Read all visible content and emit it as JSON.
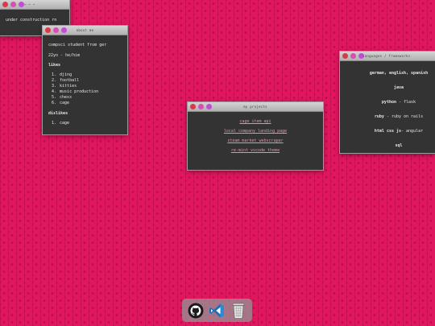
{
  "windows": {
    "construction": {
      "title": "~ ~ ~",
      "text": "under construction rn"
    },
    "about": {
      "title": "about me",
      "line1": "compsci student from ger",
      "line2": "22yo - he/him",
      "likes_heading": "likes",
      "likes": [
        {
          "num": "1.",
          "text": "djing"
        },
        {
          "num": "2.",
          "text": "football"
        },
        {
          "num": "3.",
          "text": "kitties"
        },
        {
          "num": "4.",
          "text": "music production"
        },
        {
          "num": "5.",
          "text": "chess"
        },
        {
          "num": "6.",
          "text": "cage"
        }
      ],
      "dislikes_heading": "dislikes",
      "dislikes": [
        {
          "num": "1.",
          "text": "cage"
        }
      ]
    },
    "projects": {
      "title": "my projects",
      "links": [
        "cage item api",
        "local company landing page",
        "steam market webscraper",
        "re-mint vscode theme"
      ]
    },
    "languages": {
      "title": "languages / frameworks",
      "rows": [
        {
          "bold": "german, english, spanish",
          "rest": ""
        },
        {
          "bold": "java",
          "rest": ""
        },
        {
          "bold": "python",
          "rest": " - flask"
        },
        {
          "bold": "ruby",
          "rest": " - ruby on rails"
        },
        {
          "bold": "html css js",
          "rest": "- angular"
        },
        {
          "bold": "sql",
          "rest": ""
        }
      ]
    }
  },
  "dock": {
    "items": [
      {
        "icon": "github-icon"
      },
      {
        "icon": "vscode-icon"
      },
      {
        "icon": "trash-icon"
      }
    ]
  }
}
